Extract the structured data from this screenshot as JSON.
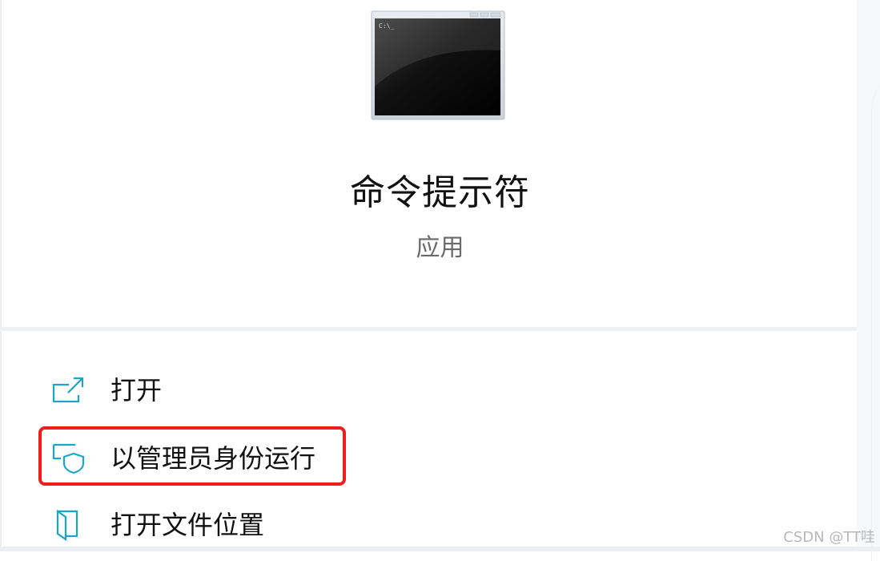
{
  "app": {
    "title": "命令提示符",
    "subtitle": "应用",
    "icon": "command-prompt-icon",
    "icon_prompt_text": "C:\\_"
  },
  "menu": {
    "items": [
      {
        "label": "打开",
        "icon": "open-external-icon"
      },
      {
        "label": "以管理员身份运行",
        "icon": "admin-shield-icon"
      },
      {
        "label": "打开文件位置",
        "icon": "file-location-icon"
      }
    ]
  },
  "annotation": {
    "color": "#f01d1d",
    "target": "以管理员身份运行"
  },
  "watermark": "CSDN @TT哇",
  "colors": {
    "accent": "#1aa6c9",
    "text": "#111111",
    "subtext": "#6a6a6a"
  }
}
